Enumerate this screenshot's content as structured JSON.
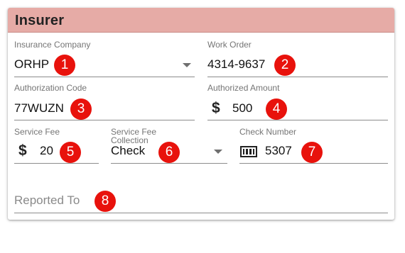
{
  "header": {
    "title": "Insurer"
  },
  "fields": {
    "insurance_company": {
      "label": "Insurance Company",
      "value": "ORHP",
      "icon": "chevron-down-icon"
    },
    "work_order": {
      "label": "Work Order",
      "value": "4314-9637"
    },
    "authorization_code": {
      "label": "Authorization Code",
      "value": "77WUZN"
    },
    "authorized_amount": {
      "label": "Authorized Amount",
      "prefix": "$",
      "value": "500",
      "icon": "dollar-icon"
    },
    "service_fee": {
      "label": "Service Fee",
      "prefix": "$",
      "value": "20",
      "icon": "dollar-icon"
    },
    "service_fee_collection": {
      "label": "Service Fee Collection",
      "value": "Check",
      "icon": "chevron-down-icon"
    },
    "check_number": {
      "label": "Check Number",
      "value": "5307",
      "icon": "check-icon"
    },
    "reported_to": {
      "placeholder": "Reported To"
    }
  },
  "badges": [
    "1",
    "2",
    "3",
    "4",
    "5",
    "6",
    "7",
    "8"
  ],
  "colors": {
    "header_bg": "#e6aba6",
    "badge": "#e8120c"
  }
}
